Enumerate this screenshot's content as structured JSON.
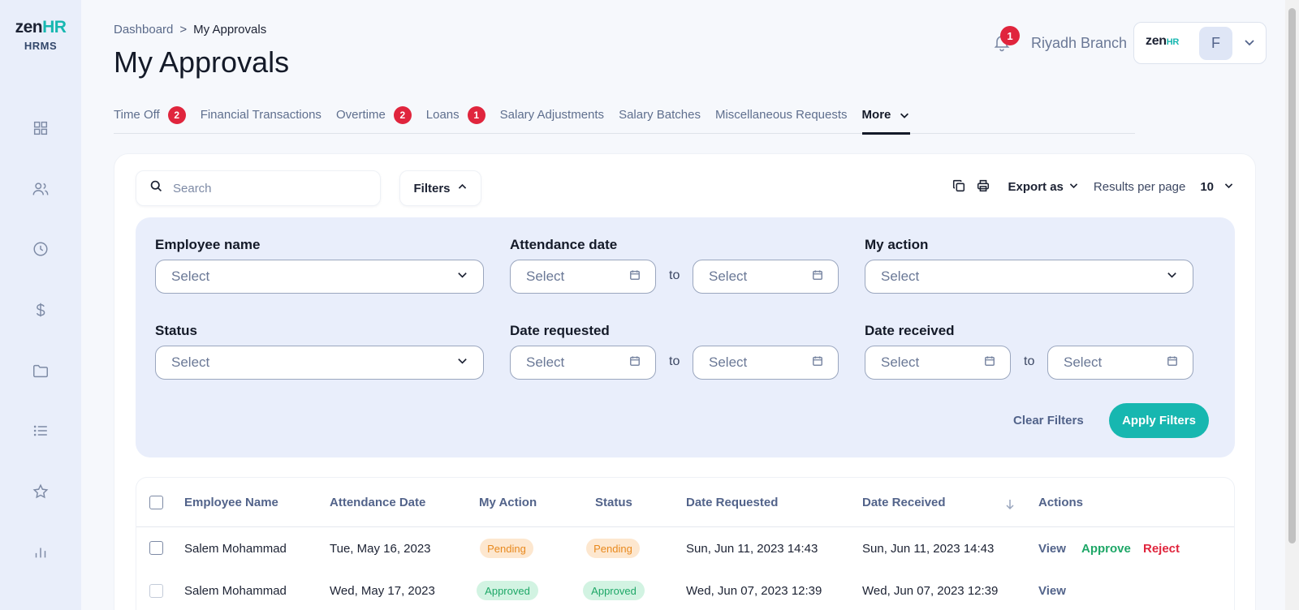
{
  "logo": {
    "word_main": "zen",
    "word_accent": "HR",
    "subtitle": "HRMS"
  },
  "sidebar": {
    "items": [
      {
        "icon": "dashboard-grid-icon"
      },
      {
        "icon": "users-icon"
      },
      {
        "icon": "clock-icon"
      },
      {
        "icon": "dollar-icon"
      },
      {
        "icon": "folder-icon"
      },
      {
        "icon": "list-icon"
      },
      {
        "icon": "star-icon"
      },
      {
        "icon": "bar-chart-icon"
      }
    ]
  },
  "breadcrumb": {
    "parent": "Dashboard",
    "separator": ">",
    "current": "My Approvals"
  },
  "page_title": "My Approvals",
  "header": {
    "notification_count": "1",
    "branch": "Riyadh Branch",
    "account_logo_main": "zen",
    "account_logo_accent": "HR",
    "avatar_initial": "F"
  },
  "tabs": [
    {
      "label": "Time Off",
      "badge": "2"
    },
    {
      "label": "Financial Transactions",
      "badge": ""
    },
    {
      "label": "Overtime",
      "badge": "2"
    },
    {
      "label": "Loans",
      "badge": "1"
    },
    {
      "label": "Salary Adjustments",
      "badge": ""
    },
    {
      "label": "Salary Batches",
      "badge": ""
    },
    {
      "label": "Miscellaneous Requests",
      "badge": ""
    },
    {
      "label": "More",
      "badge": "",
      "active": true
    }
  ],
  "toolbar": {
    "search_placeholder": "Search",
    "filters_label": "Filters",
    "export_label": "Export as",
    "results_per_page_label": "Results per page",
    "results_per_page_value": "10"
  },
  "filters": {
    "employee_name_label": "Employee name",
    "attendance_date_label": "Attendance date",
    "my_action_label": "My action",
    "status_label": "Status",
    "date_requested_label": "Date requested",
    "date_received_label": "Date received",
    "select_placeholder": "Select",
    "to_label": "to",
    "clear_label": "Clear Filters",
    "apply_label": "Apply Filters"
  },
  "table": {
    "columns": [
      "Employee Name",
      "Attendance Date",
      "My Action",
      "Status",
      "Date Requested",
      "Date Received",
      "Actions"
    ],
    "rows": [
      {
        "employee": "Salem Mohammad",
        "attendance_date": "Tue, May 16, 2023",
        "my_action": "Pending",
        "status": "Pending",
        "date_requested": "Sun, Jun 11, 2023 14:43",
        "date_received": "Sun, Jun 11, 2023 14:43",
        "actions": [
          "View",
          "Approve",
          "Reject"
        ]
      },
      {
        "employee": "Salem Mohammad",
        "attendance_date": "Wed, May 17, 2023",
        "my_action": "Approved",
        "status": "Approved",
        "date_requested": "Wed, Jun 07, 2023 12:39",
        "date_received": "Wed, Jun 07, 2023 12:39",
        "actions": [
          "View"
        ]
      }
    ]
  },
  "colors": {
    "accent": "#17b7b0",
    "badge_red": "#e0253d",
    "pending": "#e8891e",
    "approved": "#1ea767",
    "sidebar_bg": "#e9eefa",
    "filter_panel_bg": "#e9eefb"
  }
}
